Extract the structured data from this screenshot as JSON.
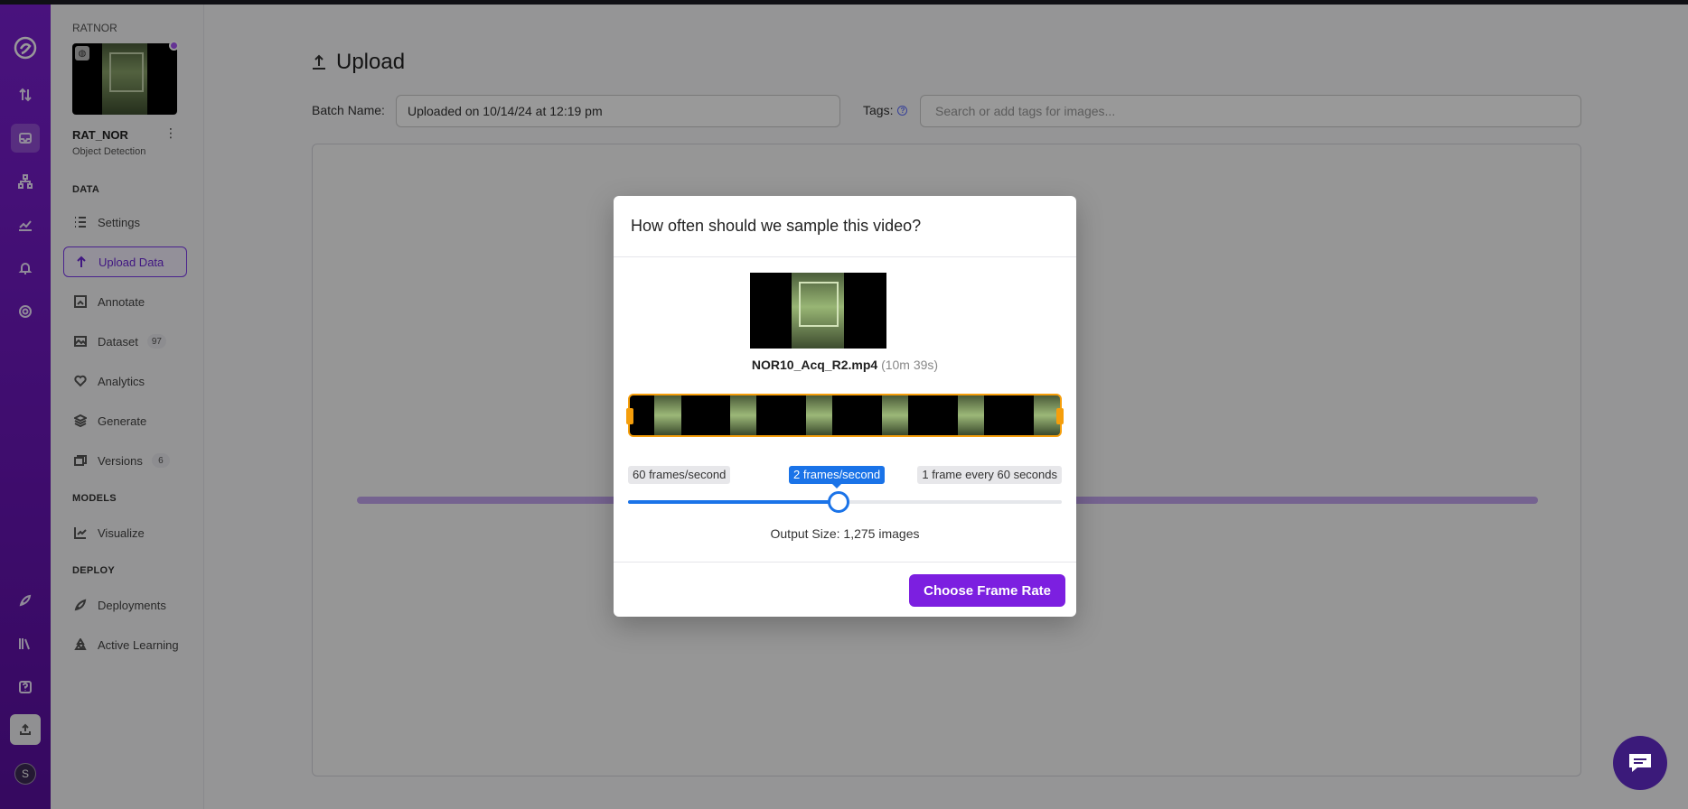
{
  "workspace": {
    "name": "RATNOR"
  },
  "project": {
    "name": "RAT_NOR",
    "type": "Object Detection"
  },
  "sidebar": {
    "sections": [
      {
        "label": "DATA"
      },
      {
        "label": "MODELS"
      },
      {
        "label": "DEPLOY"
      }
    ],
    "items": [
      {
        "label": "Settings"
      },
      {
        "label": "Upload Data"
      },
      {
        "label": "Annotate"
      },
      {
        "label": "Dataset",
        "badge": "97"
      },
      {
        "label": "Analytics"
      },
      {
        "label": "Generate"
      },
      {
        "label": "Versions",
        "badge": "6"
      },
      {
        "label": "Visualize"
      },
      {
        "label": "Deployments"
      },
      {
        "label": "Active Learning"
      }
    ]
  },
  "rail": {
    "avatar_initial": "S"
  },
  "page": {
    "title": "Upload",
    "batch_label": "Batch Name:",
    "batch_value": "Uploaded on 10/14/24 at 12:19 pm",
    "tags_label": "Tags:",
    "tags_placeholder": "Search or add tags for images..."
  },
  "modal": {
    "title": "How often should we sample this video?",
    "file_name": "NOR10_Acq_R2.mp4",
    "file_duration": "(10m 39s)",
    "slider": {
      "min_label": "60 frames/second",
      "current_label": "2 frames/second",
      "max_label": "1 frame every 60 seconds",
      "position_fraction": 0.485
    },
    "output_size": "Output Size: 1,275 images",
    "button_label": "Choose Frame Rate"
  },
  "colors": {
    "accent": "#7c1fe0",
    "slider": "#1a73e8",
    "trim": "#f59e0b"
  }
}
